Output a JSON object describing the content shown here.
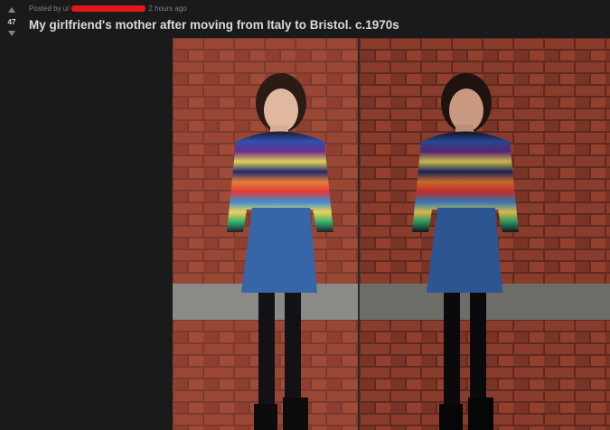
{
  "post": {
    "score": "47",
    "posted_by_prefix": "Posted by u/",
    "time_ago": "2 hours ago",
    "title": "My girlfriend's mother after moving from Italy to Bristol. c.1970s"
  },
  "icons": {
    "upvote": "upvote-arrow-icon",
    "downvote": "downvote-arrow-icon"
  },
  "colors": {
    "background": "#1a1a1b",
    "text": "#d7dadc",
    "meta": "#818384",
    "redaction": "#e3171b"
  }
}
